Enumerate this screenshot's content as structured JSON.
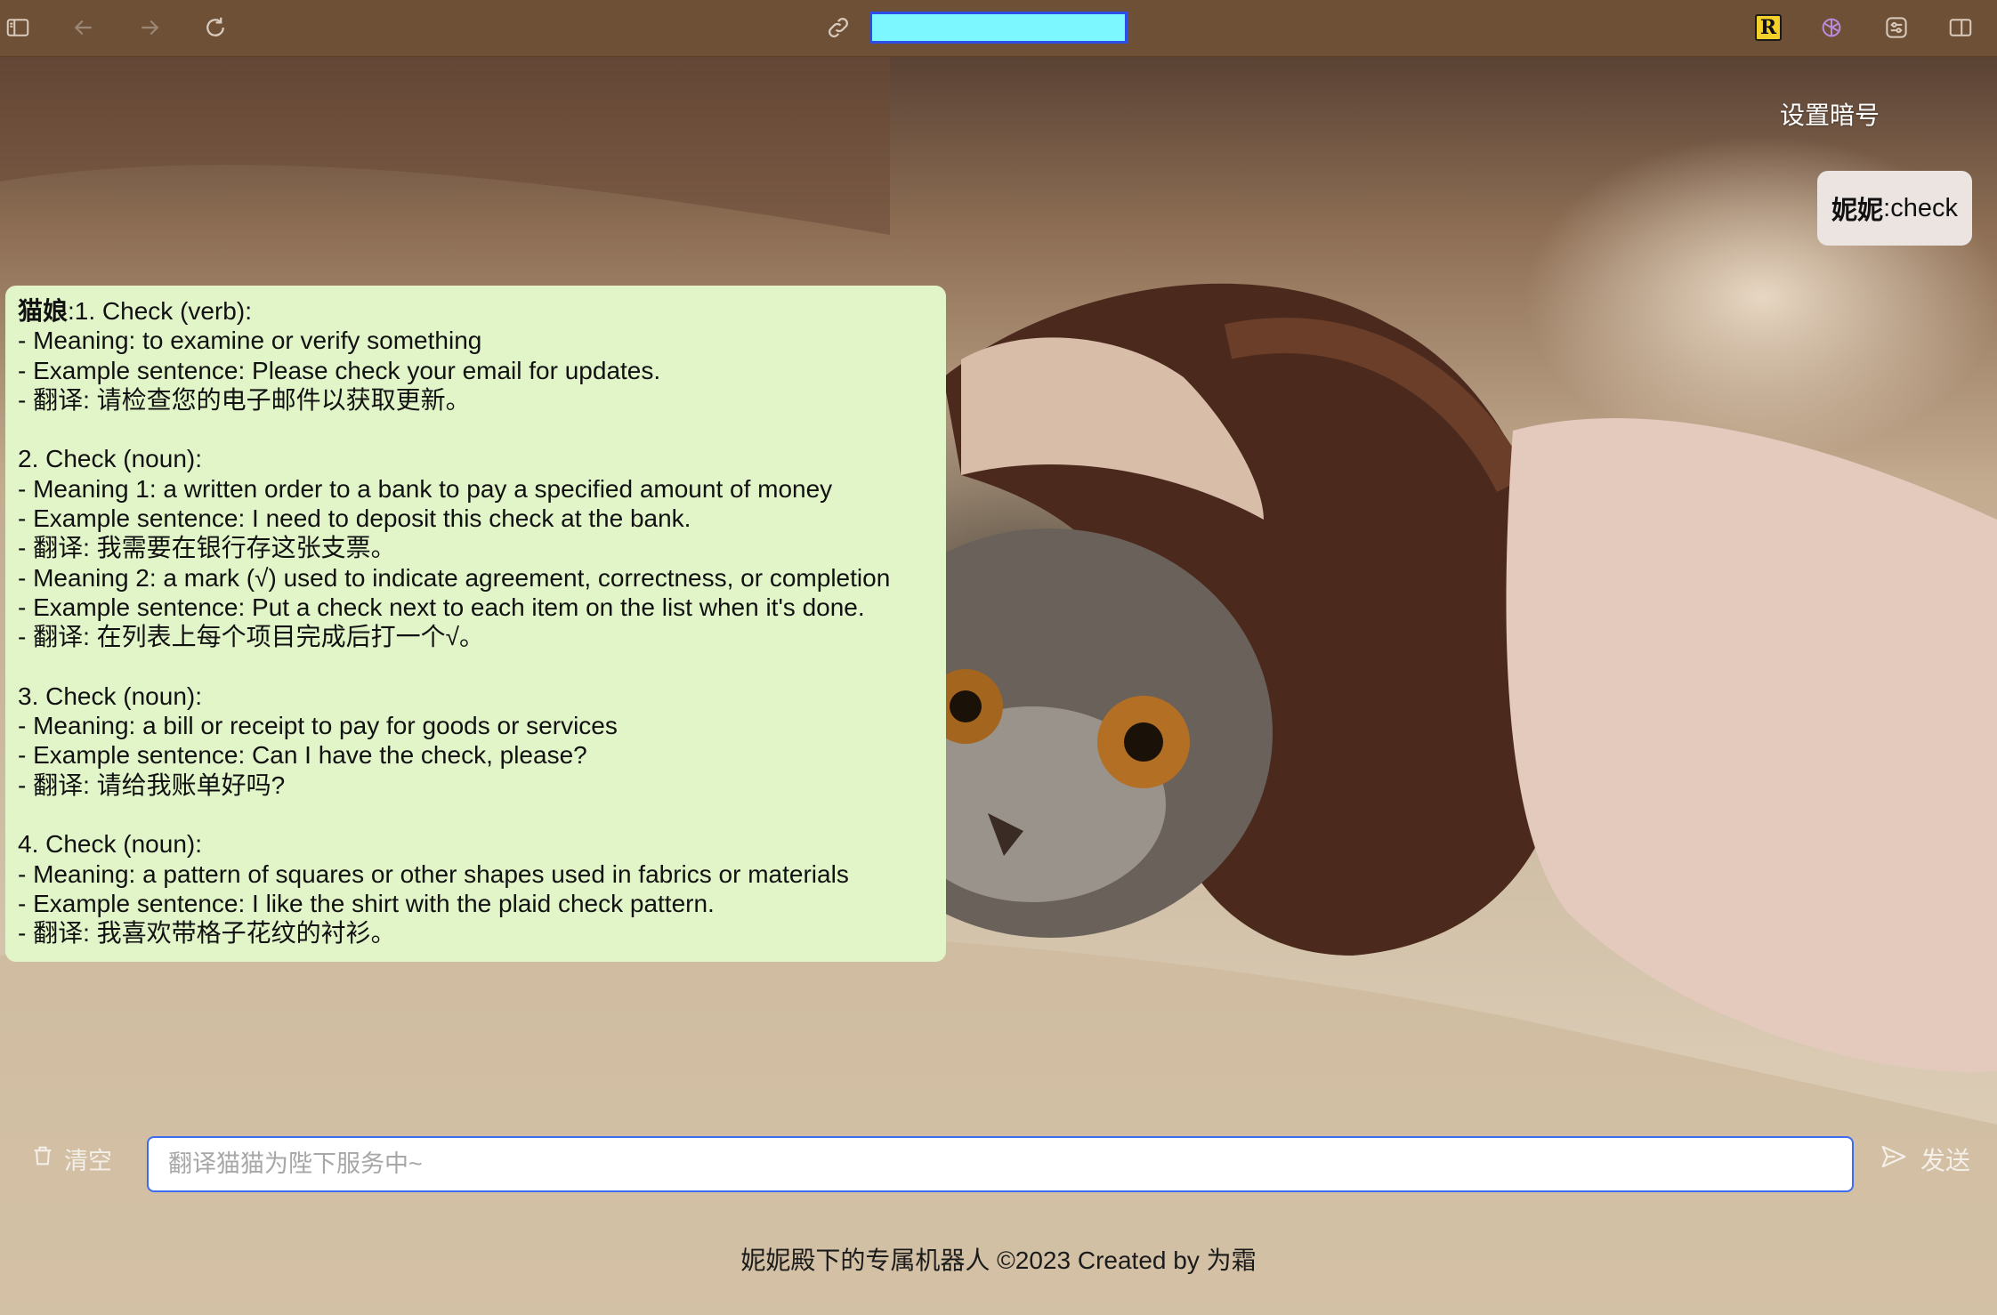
{
  "toolbar": {
    "icons": [
      "sidebar-icon",
      "back-arrow-icon",
      "forward-arrow-icon",
      "reload-icon",
      "link-icon",
      "r-extension-icon",
      "openai-icon",
      "settings-sliders-icon",
      "split-view-icon"
    ],
    "extension_letter": "R",
    "colors": {
      "toolbar_bg": "#6e5037",
      "url_highlight": "#7cf7ff",
      "url_border": "#2b4fe6"
    }
  },
  "header": {
    "set_code": "设置暗号"
  },
  "user_message": {
    "sender": "妮妮",
    "separator": ":",
    "text": "check"
  },
  "bot_message": {
    "sender": "猫娘",
    "separator": ":",
    "first_line": "1. Check (verb):",
    "lines": [
      "- Meaning: to examine or verify something",
      "- Example sentence: Please check your email for updates.",
      "- 翻译: 请检查您的电子邮件以获取更新。",
      "",
      "2. Check (noun):",
      "- Meaning 1: a written order to a bank to pay a specified amount of money",
      "- Example sentence: I need to deposit this check at the bank.",
      "- 翻译: 我需要在银行存这张支票。",
      "- Meaning 2: a mark (√) used to indicate agreement, correctness, or completion",
      "- Example sentence: Put a check next to each item on the list when it's done.",
      "- 翻译: 在列表上每个项目完成后打一个√。",
      "",
      "3. Check (noun):",
      "- Meaning: a bill or receipt to pay for goods or services",
      "- Example sentence: Can I have the check, please?",
      "- 翻译: 请给我账单好吗?",
      "",
      "4. Check (noun):",
      "- Meaning: a pattern of squares or other shapes used in fabrics or materials",
      "- Example sentence: I like the shirt with the plaid check pattern.",
      "- 翻译: 我喜欢带格子花纹的衬衫。"
    ],
    "bubble_color": "#e2f5c9"
  },
  "input": {
    "clear_label": "清空",
    "placeholder": "翻译猫猫为陛下服务中~",
    "value": "",
    "send_label": "发送"
  },
  "footer": {
    "text": "妮妮殿下的专属机器人 ©2023 Created by 为霜"
  }
}
